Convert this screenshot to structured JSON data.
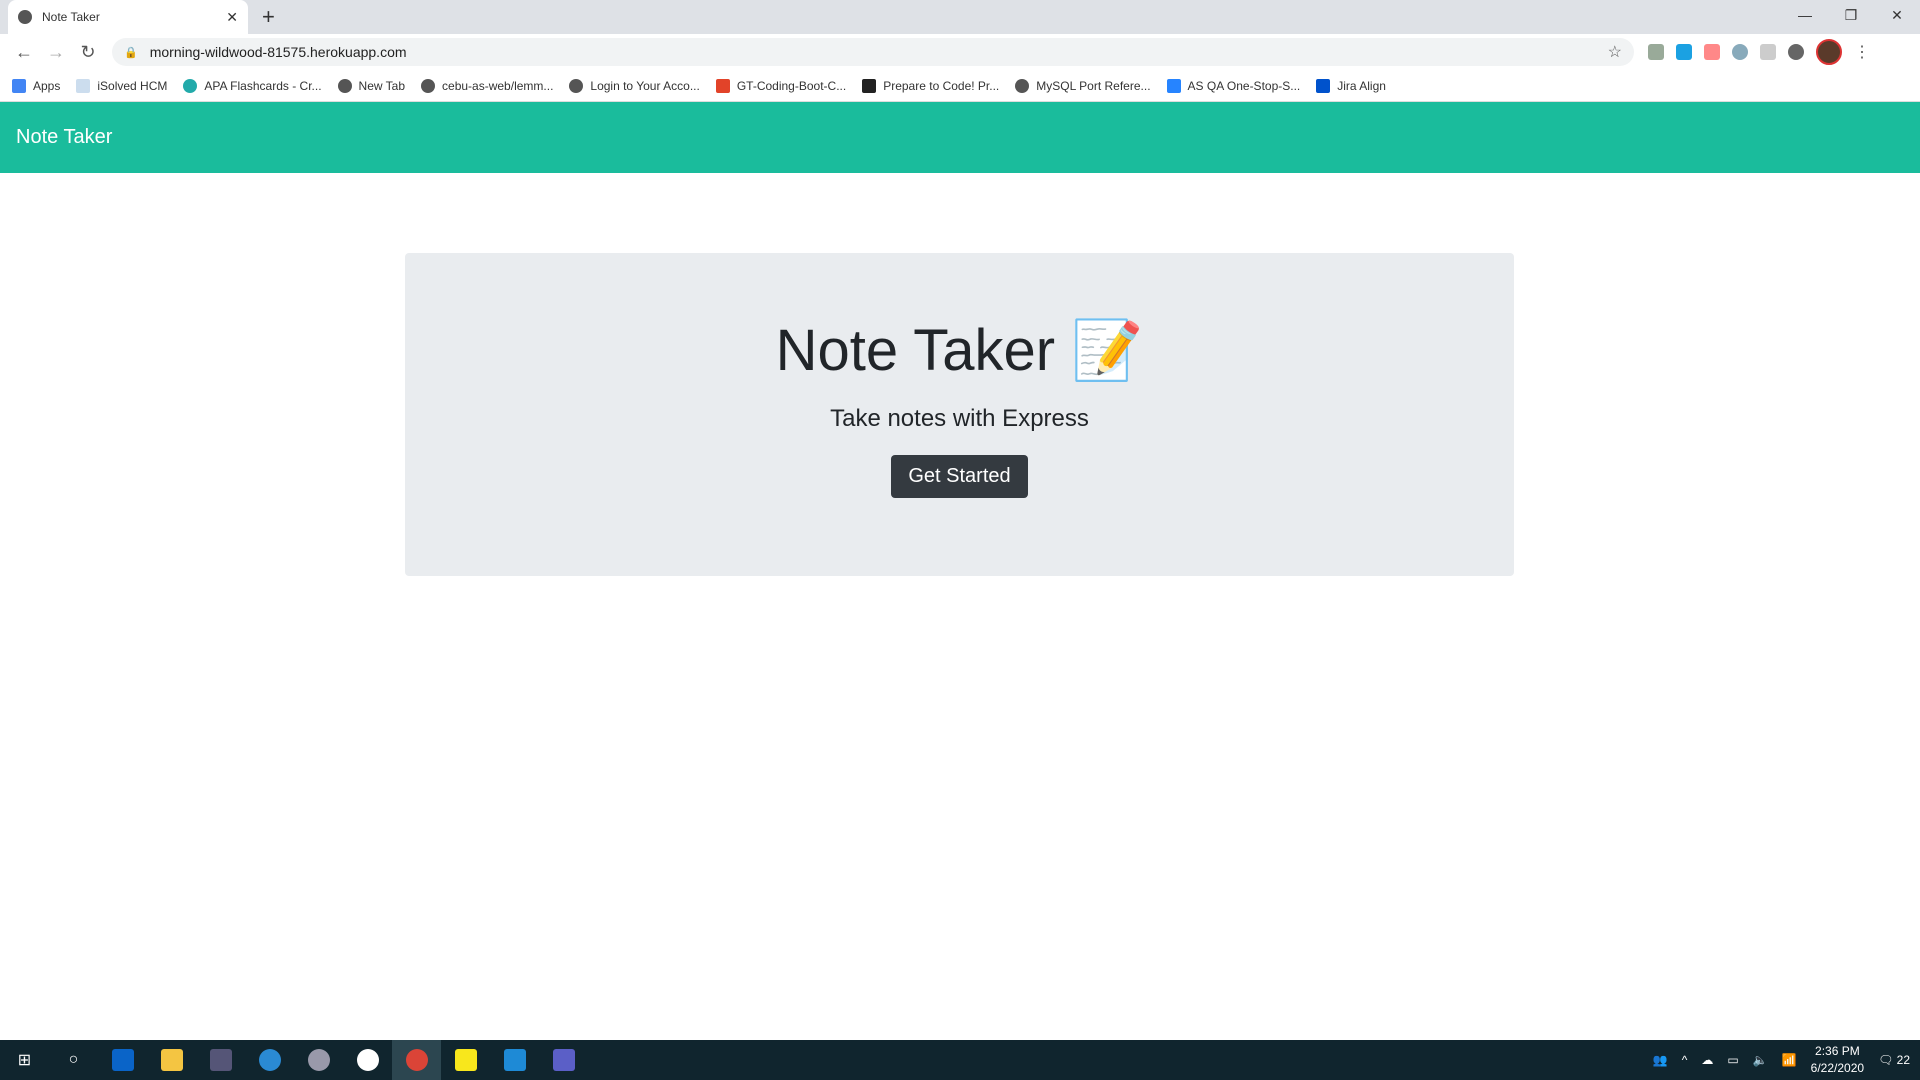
{
  "browser": {
    "tab_title": "Note Taker",
    "url": "morning-wildwood-81575.herokuapp.com",
    "bookmarks": [
      "Apps",
      "iSolved HCM",
      "APA Flashcards - Cr...",
      "New Tab",
      "cebu-as-web/lemm...",
      "Login to Your Acco...",
      "GT-Coding-Boot-C...",
      "Prepare to Code! Pr...",
      "MySQL Port Refere...",
      "AS QA One-Stop-S...",
      "Jira Align"
    ]
  },
  "navbar": {
    "brand": "Note Taker"
  },
  "hero": {
    "title": "Note Taker 📝",
    "subtitle": "Take notes with Express",
    "button": "Get Started"
  },
  "colors": {
    "navbar": "#1abc9c",
    "jumbotron": "#e9ecef",
    "button": "#343a40"
  },
  "taskbar": {
    "time": "2:36 PM",
    "date": "6/22/2020",
    "notifications": "22"
  }
}
